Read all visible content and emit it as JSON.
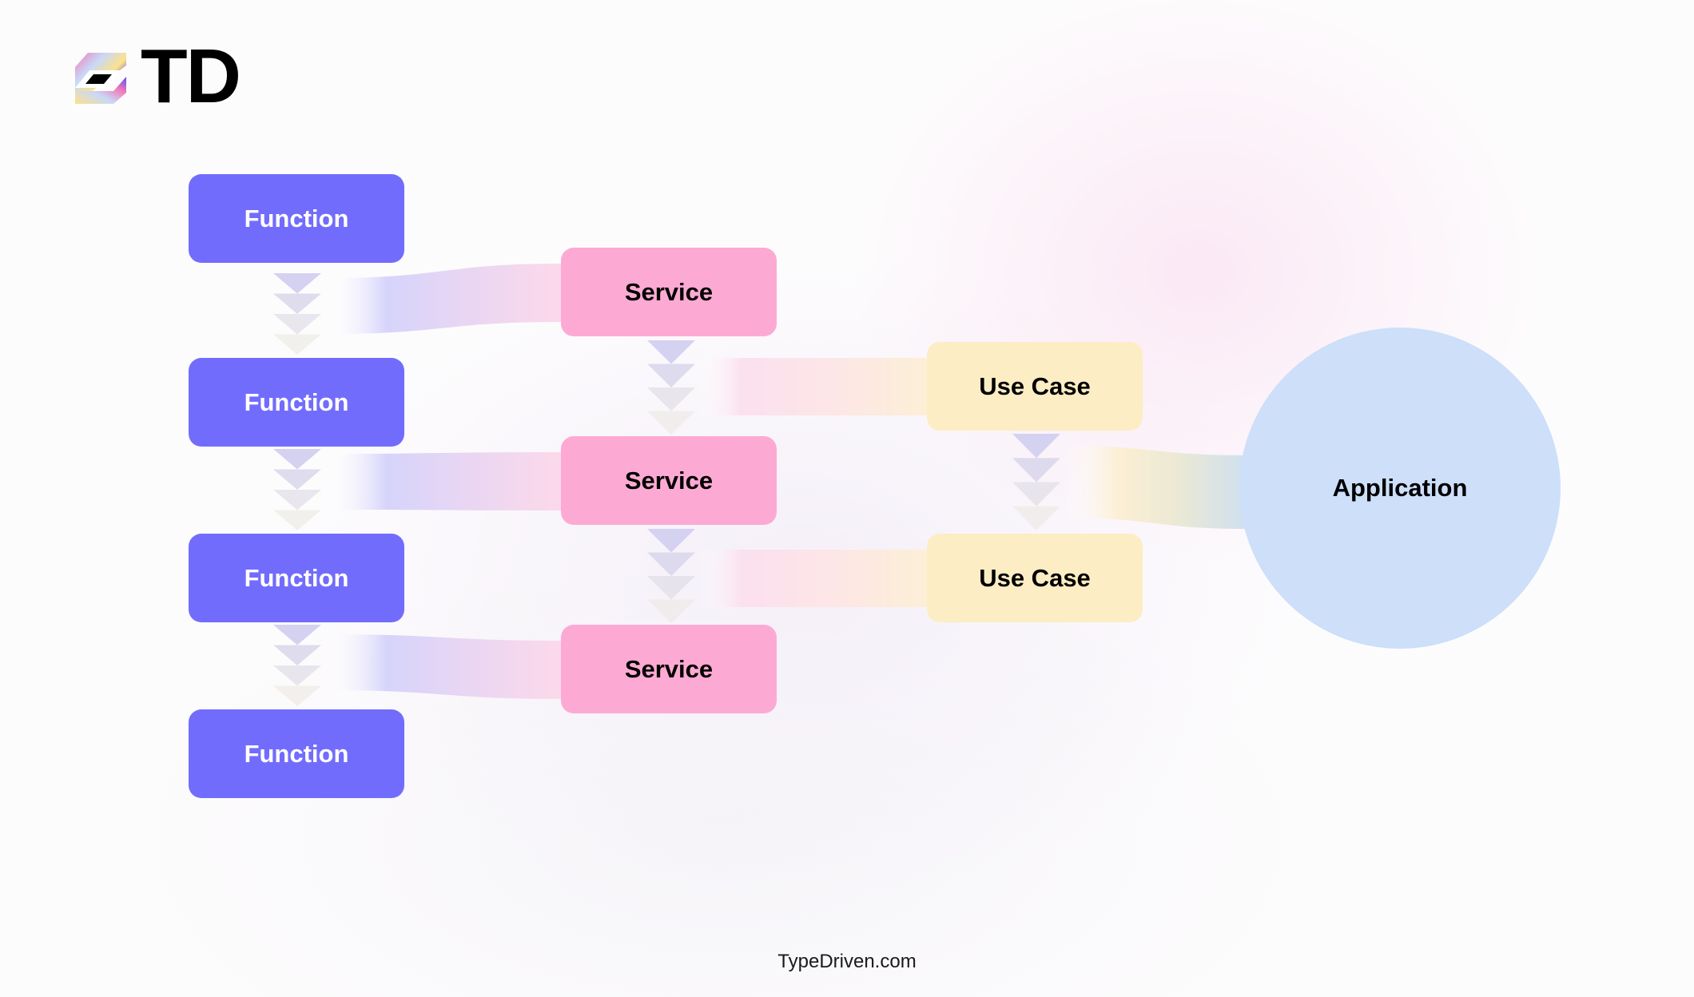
{
  "brand": {
    "name": "TD",
    "logo_icon": "td-cube-logo-icon"
  },
  "colors": {
    "function": "#726cfd",
    "service": "#fcaad3",
    "use_case": "#fcedc4",
    "application": "#cddff9",
    "chevron": "#d6d2ee",
    "background": "#fdfcfd"
  },
  "diagram": {
    "functions": [
      {
        "label": "Function"
      },
      {
        "label": "Function"
      },
      {
        "label": "Function"
      },
      {
        "label": "Function"
      }
    ],
    "services": [
      {
        "label": "Service"
      },
      {
        "label": "Service"
      },
      {
        "label": "Service"
      }
    ],
    "use_cases": [
      {
        "label": "Use Case"
      },
      {
        "label": "Use Case"
      }
    ],
    "application": {
      "label": "Application"
    },
    "connections": [
      {
        "from": "functions[0-1]",
        "to": "services[0]"
      },
      {
        "from": "functions[1-2]",
        "to": "services[1]"
      },
      {
        "from": "functions[2-3]",
        "to": "services[2]"
      },
      {
        "from": "services[0-1]",
        "to": "use_cases[0]"
      },
      {
        "from": "services[1-2]",
        "to": "use_cases[1]"
      },
      {
        "from": "use_cases[0-1]",
        "to": "application"
      }
    ]
  },
  "footer": {
    "text": "TypeDriven.com"
  }
}
